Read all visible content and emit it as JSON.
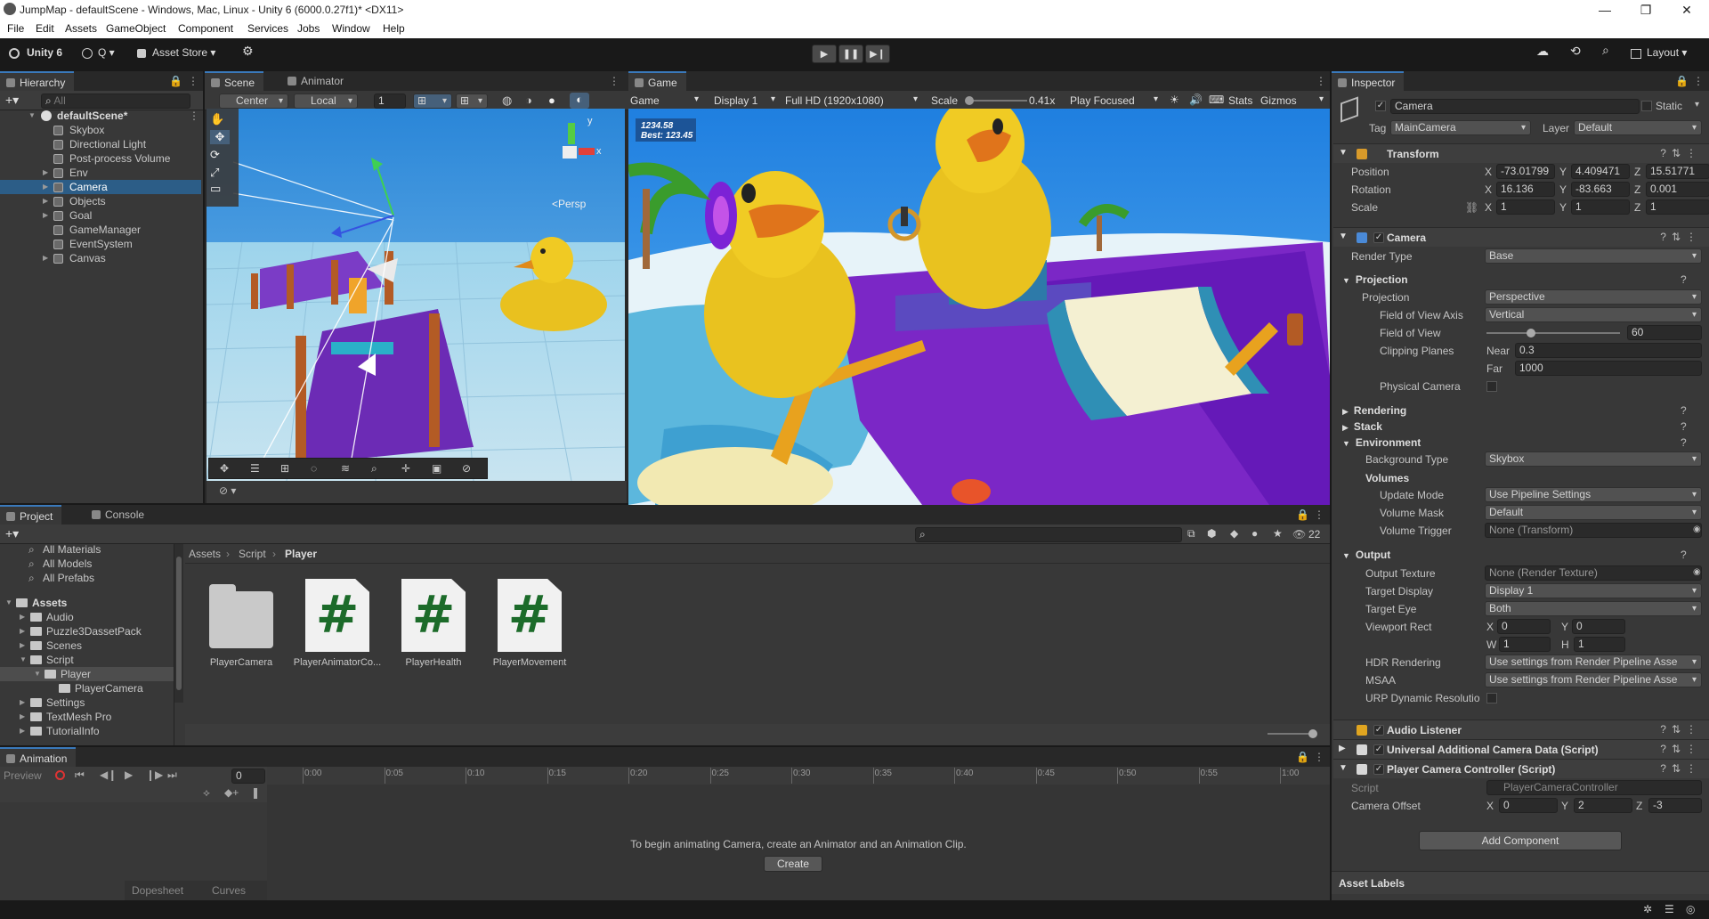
{
  "window": {
    "title": "JumpMap - defaultScene - Windows, Mac, Linux - Unity 6 (6000.0.27f1)* <DX11>",
    "minimize": "—",
    "maximize": "❐",
    "close": "✕"
  },
  "menu": [
    "File",
    "Edit",
    "Assets",
    "GameObject",
    "Component",
    "Services",
    "Jobs",
    "Window",
    "Help"
  ],
  "toolbar": {
    "unity_label": "Unity 6",
    "account_label": "Q ▾",
    "asset_store": "Asset Store ▾",
    "layout": "Layout ▾"
  },
  "hierarchy": {
    "tab": "Hierarchy",
    "search_placeholder": "All",
    "scene": "defaultScene*",
    "items": [
      {
        "label": "Skybox",
        "expandable": false
      },
      {
        "label": "Directional Light",
        "expandable": false
      },
      {
        "label": "Post-process Volume",
        "expandable": false
      },
      {
        "label": "Env",
        "expandable": true
      },
      {
        "label": "Camera",
        "expandable": true,
        "selected": true
      },
      {
        "label": "Objects",
        "expandable": true
      },
      {
        "label": "Goal",
        "expandable": true
      },
      {
        "label": "GameManager",
        "expandable": false
      },
      {
        "label": "EventSystem",
        "expandable": false
      },
      {
        "label": "Canvas",
        "expandable": true
      }
    ]
  },
  "scene_view": {
    "tabs": [
      "Scene",
      "Animator"
    ],
    "pivot": "Center",
    "space": "Local",
    "grid_value": "1",
    "persp_label": "<Persp",
    "axis_y": "y",
    "axis_x": "x"
  },
  "game_view": {
    "tab": "Game",
    "mode": "Game",
    "display": "Display 1",
    "resolution": "Full HD (1920x1080)",
    "scale_label": "Scale",
    "scale_value": "0.41x",
    "play_mode": "Play Focused",
    "stats": "Stats",
    "gizmos": "Gizmos",
    "hud_time": "1234.58",
    "hud_best": "Best: 123.45"
  },
  "inspector": {
    "tab": "Inspector",
    "object_name": "Camera",
    "static_label": "Static",
    "tag_label": "Tag",
    "tag_value": "MainCamera",
    "layer_label": "Layer",
    "layer_value": "Default",
    "transform": {
      "title": "Transform",
      "position_label": "Position",
      "position": {
        "x": "-73.01799",
        "y": "4.409471",
        "z": "15.51771"
      },
      "rotation_label": "Rotation",
      "rotation": {
        "x": "16.136",
        "y": "-83.663",
        "z": "0.001"
      },
      "scale_label": "Scale",
      "scale": {
        "x": "1",
        "y": "1",
        "z": "1"
      }
    },
    "camera": {
      "title": "Camera",
      "render_type_label": "Render Type",
      "render_type": "Base",
      "projection_section": "Projection",
      "projection_label": "Projection",
      "projection": "Perspective",
      "fov_axis_label": "Field of View Axis",
      "fov_axis": "Vertical",
      "fov_label": "Field of View",
      "fov": "60",
      "fov_fraction": 0.33,
      "clip_label": "Clipping Planes",
      "near_label": "Near",
      "near": "0.3",
      "far_label": "Far",
      "far": "1000",
      "physical_label": "Physical Camera",
      "rendering_section": "Rendering",
      "stack_section": "Stack",
      "environment_section": "Environment",
      "bg_type_label": "Background Type",
      "bg_type": "Skybox",
      "volumes_label": "Volumes",
      "update_mode_label": "Update Mode",
      "update_mode": "Use Pipeline Settings",
      "volume_mask_label": "Volume Mask",
      "volume_mask": "Default",
      "volume_trigger_label": "Volume Trigger",
      "volume_trigger": "None (Transform)",
      "output_section": "Output",
      "output_texture_label": "Output Texture",
      "output_texture": "None (Render Texture)",
      "target_display_label": "Target Display",
      "target_display": "Display 1",
      "target_eye_label": "Target Eye",
      "target_eye": "Both",
      "viewport_label": "Viewport Rect",
      "viewport": {
        "x": "0",
        "y": "0",
        "w": "1",
        "h": "1"
      },
      "hdr_label": "HDR Rendering",
      "hdr": "Use settings from Render Pipeline Asse",
      "msaa_label": "MSAA",
      "msaa": "Use settings from Render Pipeline Asse",
      "urp_dyn_label": "URP Dynamic Resolutio"
    },
    "audio_listener": "Audio Listener",
    "urp_camera_data": "Universal Additional Camera Data (Script)",
    "player_camera": {
      "title": "Player Camera Controller (Script)",
      "script_label": "Script",
      "script_value": "PlayerCameraController",
      "offset_label": "Camera Offset",
      "offset": {
        "x": "0",
        "y": "2",
        "z": "-3"
      }
    },
    "add_component": "Add Component",
    "asset_labels": "Asset Labels"
  },
  "project": {
    "tabs": [
      "Project",
      "Console"
    ],
    "count": "22",
    "favorites": [
      "All Materials",
      "All Models",
      "All Prefabs"
    ],
    "tree": [
      {
        "label": "Assets",
        "depth": 0,
        "bold": true
      },
      {
        "label": "Audio",
        "depth": 1
      },
      {
        "label": "Puzzle3DassetPack",
        "depth": 1
      },
      {
        "label": "Scenes",
        "depth": 1
      },
      {
        "label": "Script",
        "depth": 1
      },
      {
        "label": "Player",
        "depth": 2,
        "selected": true
      },
      {
        "label": "PlayerCamera",
        "depth": 3
      },
      {
        "label": "Settings",
        "depth": 1
      },
      {
        "label": "TextMesh Pro",
        "depth": 1
      },
      {
        "label": "TutorialInfo",
        "depth": 1
      }
    ],
    "breadcrumb": [
      "Assets",
      "Script",
      "Player"
    ],
    "files": [
      {
        "name": "PlayerCamera",
        "kind": "folder"
      },
      {
        "name": "PlayerAnimatorCo...",
        "kind": "script"
      },
      {
        "name": "PlayerHealth",
        "kind": "script"
      },
      {
        "name": "PlayerMovement",
        "kind": "script"
      }
    ]
  },
  "animation": {
    "tab": "Animation",
    "preview": "Preview",
    "frame": "0",
    "ticks": [
      "0:00",
      "0:05",
      "0:10",
      "0:15",
      "0:20",
      "0:25",
      "0:30",
      "0:35",
      "0:40",
      "0:45",
      "0:50",
      "0:55",
      "1:00"
    ],
    "message": "To begin animating Camera, create an Animator and an Animation Clip.",
    "create": "Create",
    "dopesheet": "Dopesheet",
    "curves": "Curves"
  }
}
